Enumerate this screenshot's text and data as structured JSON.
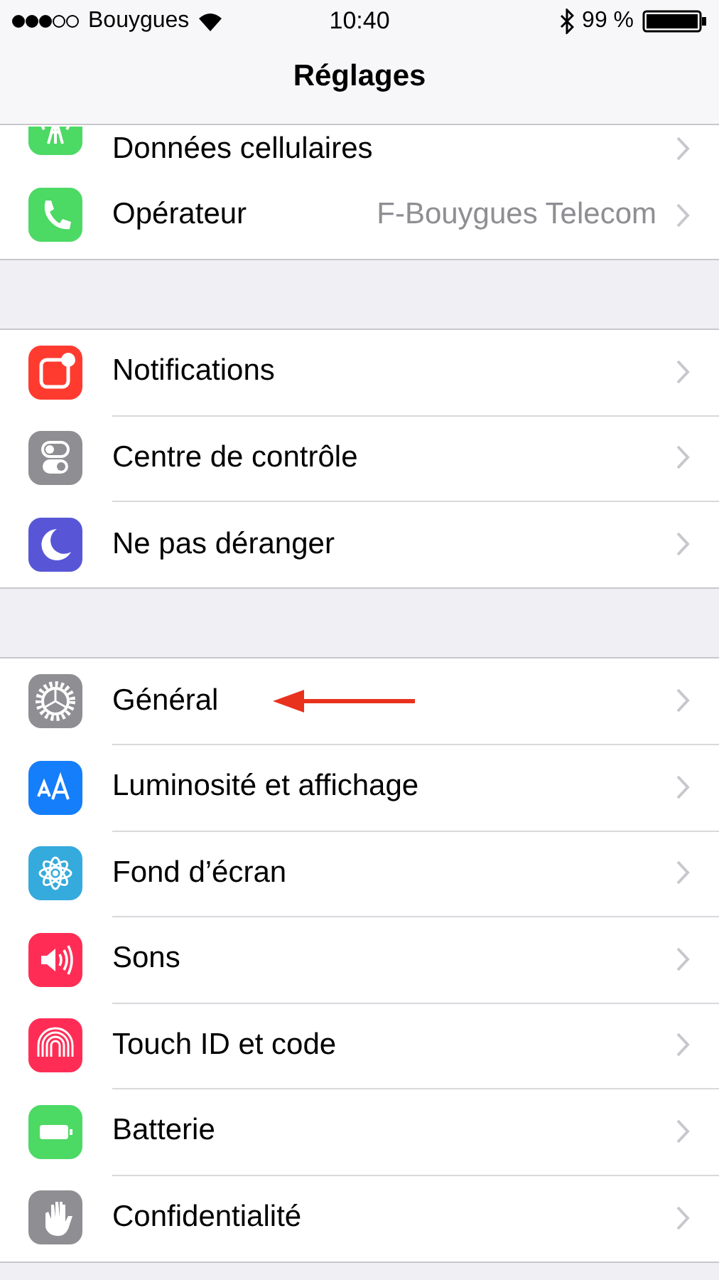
{
  "status_bar": {
    "carrier": "Bouygues",
    "time": "10:40",
    "battery": "99 %"
  },
  "nav": {
    "title": "Réglages"
  },
  "groups": [
    {
      "rows": [
        {
          "label": "Données cellulaires",
          "color": "#4cd964",
          "arrow": false
        },
        {
          "label": "Opérateur",
          "value": "F-Bouygues Telecom",
          "color": "#4cd964",
          "arrow": false
        }
      ]
    },
    {
      "rows": [
        {
          "label": "Notifications",
          "color": "#ff3b30",
          "arrow": false
        },
        {
          "label": "Centre de contrôle",
          "color": "#8e8e93",
          "arrow": false
        },
        {
          "label": "Ne pas déranger",
          "color": "#5856d6",
          "arrow": false
        }
      ]
    },
    {
      "rows": [
        {
          "label": "Général",
          "color": "#8e8e93",
          "arrow": true
        },
        {
          "label": "Luminosité et affichage",
          "color": "#147efb",
          "arrow": false
        },
        {
          "label": "Fond d’écran",
          "color": "#35aadc",
          "arrow": false
        },
        {
          "label": "Sons",
          "color": "#ff2d55",
          "arrow": false
        },
        {
          "label": "Touch ID et code",
          "color": "#ff2d55",
          "arrow": false
        },
        {
          "label": "Batterie",
          "color": "#4cd964",
          "arrow": false
        },
        {
          "label": "Confidentialité",
          "color": "#8e8e93",
          "arrow": false
        }
      ]
    }
  ]
}
